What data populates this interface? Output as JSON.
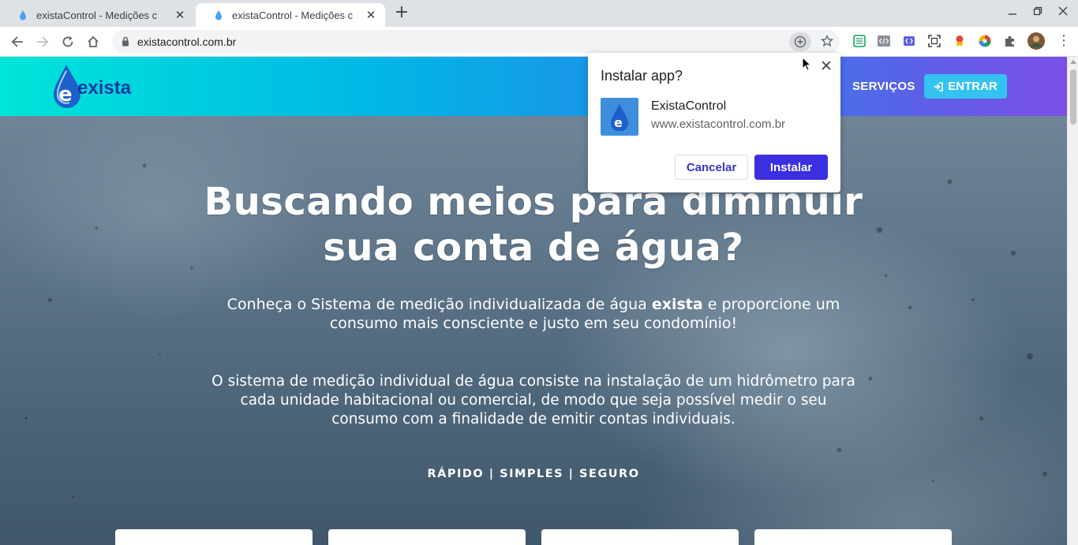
{
  "browser": {
    "tabs": [
      {
        "title": "existaControl - Medições c"
      },
      {
        "title": "existaControl - Medições c"
      }
    ],
    "new_tab_label": "+",
    "url": "existacontrol.com.br"
  },
  "nav": {
    "logo_text": "exista",
    "servicos": "SERVIÇOS",
    "entrar": "ENTRAR"
  },
  "hero": {
    "title_line1": "Buscando meios para diminuir",
    "title_line2": "sua conta de água?",
    "sub_pre": "Conheça o Sistema de medição individualizada de água ",
    "sub_bold": "exista",
    "sub_post": " e proporcione um consumo mais consciente e justo em seu condomínio!",
    "desc": "O sistema de medição individual de água consiste na instalação de um hidrômetro para cada unidade habitacional ou comercial, de modo que seja possível medir o seu consumo com a finalidade de emitir contas individuais.",
    "tagline": "RÁPIDO | SIMPLES | SEGURO"
  },
  "popup": {
    "title": "Instalar app?",
    "app_name": "ExistaControl",
    "app_url": "www.existacontrol.com.br",
    "cancel": "Cancelar",
    "install": "Instalar"
  },
  "colors": {
    "nav_gradient_start": "#00e5d8",
    "nav_gradient_end": "#7b4fe6",
    "entrar_button": "#34c3f0",
    "install_button": "#3b2fe0"
  }
}
